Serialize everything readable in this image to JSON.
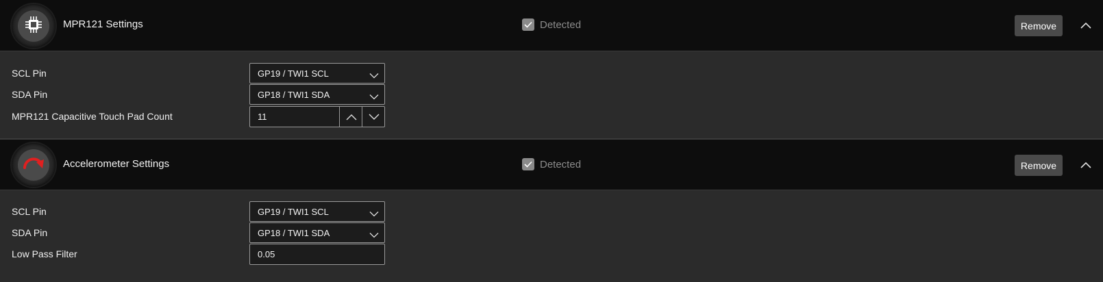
{
  "panels": [
    {
      "title": "MPR121 Settings",
      "icon": "chip-icon",
      "detected_label": "Detected",
      "detected_checked": true,
      "remove_label": "Remove",
      "rows": [
        {
          "label": "SCL Pin",
          "value": "GP19 / TWI1 SCL"
        },
        {
          "label": "SDA Pin",
          "value": "GP18 / TWI1 SDA"
        },
        {
          "label": "MPR121 Capacitive Touch Pad Count",
          "value": "11"
        }
      ]
    },
    {
      "title": "Accelerometer Settings",
      "icon": "rotate-arrow-icon",
      "detected_label": "Detected",
      "detected_checked": true,
      "remove_label": "Remove",
      "rows": [
        {
          "label": "SCL Pin",
          "value": "GP19 / TWI1 SCL"
        },
        {
          "label": "SDA Pin",
          "value": "GP18 / TWI1 SDA"
        },
        {
          "label": "Low Pass Filter",
          "value": "0.05"
        }
      ]
    }
  ],
  "colors": {
    "header_bg": "#0d0d0d",
    "body_bg": "#2b2b2b",
    "accent_red": "#e02020"
  }
}
